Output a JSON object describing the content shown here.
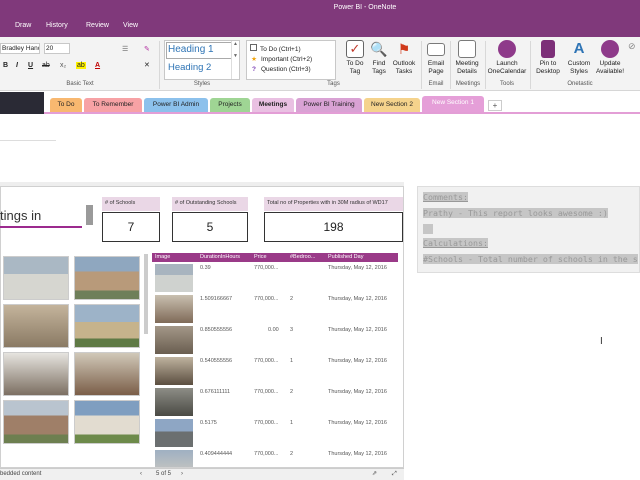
{
  "window": {
    "title": "Power BI  -  OneNote"
  },
  "ribbon_tabs": [
    "Draw",
    "History",
    "Review",
    "View"
  ],
  "ribbon": {
    "font_name": "Bradley Hanc",
    "font_size": "20",
    "group_labels": {
      "basic_text": "Basic Text",
      "styles": "Styles",
      "tags": "Tags",
      "email": "Email",
      "meetings": "Meetings",
      "tools": "Tools",
      "onetastic": "Onetastic"
    },
    "styles": {
      "heading1": "Heading 1",
      "heading2": "Heading 2"
    },
    "tags": [
      {
        "label": "To Do (Ctrl+1)",
        "icon": "checkbox-icon"
      },
      {
        "label": "Important (Ctrl+2)",
        "icon": "star-icon"
      },
      {
        "label": "Question (Ctrl+3)",
        "icon": "question-icon"
      }
    ],
    "buttons": {
      "todo_tag": "To Do\nTag",
      "find_tags": "Find\nTags",
      "outlook_tasks": "Outlook\nTasks",
      "email_page": "Email\nPage",
      "meeting_details": "Meeting\nDetails",
      "launch_onecalendar": "Launch\nOneCalendar",
      "pin_to_desktop": "Pin to\nDesktop",
      "custom_styles": "Custom\nStyles",
      "update_available": "Update\nAvailable!"
    }
  },
  "sections": [
    {
      "label": "To Do",
      "color": "#f8b870"
    },
    {
      "label": "To Remember",
      "color": "#f7a2a5"
    },
    {
      "label": "Power BI Admin",
      "color": "#8cc1ec"
    },
    {
      "label": "Projects",
      "color": "#9fd594"
    },
    {
      "label": "Meetings",
      "color": "#e9c0e2",
      "active": true
    },
    {
      "label": "Power BI Training",
      "color": "#d9a2d4"
    },
    {
      "label": "New Section 2",
      "color": "#f5d38c"
    },
    {
      "label": "New Section 1",
      "color": "#e59fd8"
    }
  ],
  "report": {
    "title_fragment": "tings in",
    "cards": [
      {
        "label": "# of Schools",
        "value": "7"
      },
      {
        "label": "# of Outstanding Schools",
        "value": "5"
      },
      {
        "label": "Total no of Properties with in 30M radius of WD17",
        "value": "198"
      }
    ],
    "table": {
      "columns": [
        "Image",
        "DurationInHours",
        "Price",
        "#Bedroo...",
        "Published Day"
      ],
      "rows": [
        {
          "duration": "0.39",
          "price": "770,000...",
          "beds": "",
          "day": "Thursday, May 12, 2016"
        },
        {
          "duration": "1.509166667",
          "price": "770,000...",
          "beds": "2",
          "day": "Thursday, May 12, 2016"
        },
        {
          "duration": "0.850555556",
          "price": "0.00",
          "beds": "3",
          "day": "Thursday, May 12, 2016"
        },
        {
          "duration": "0.540555556",
          "price": "770,000...",
          "beds": "1",
          "day": "Thursday, May 12, 2016"
        },
        {
          "duration": "0.676111111",
          "price": "770,000...",
          "beds": "2",
          "day": "Thursday, May 12, 2016"
        },
        {
          "duration": "0.5175",
          "price": "770,000...",
          "beds": "1",
          "day": "Thursday, May 12, 2016"
        },
        {
          "duration": "0.409444444",
          "price": "770,000...",
          "beds": "2",
          "day": "Thursday, May 12, 2016"
        }
      ]
    },
    "footer": {
      "embedded": "bedded content",
      "pagination": "5 of 5"
    }
  },
  "notes": {
    "comments_heading": "Comments:",
    "comment_line": "Prathy - This report looks awesome :)",
    "calculations_heading": "Calculations:",
    "calc_line": "#Schools - Total number of schools in the s"
  }
}
